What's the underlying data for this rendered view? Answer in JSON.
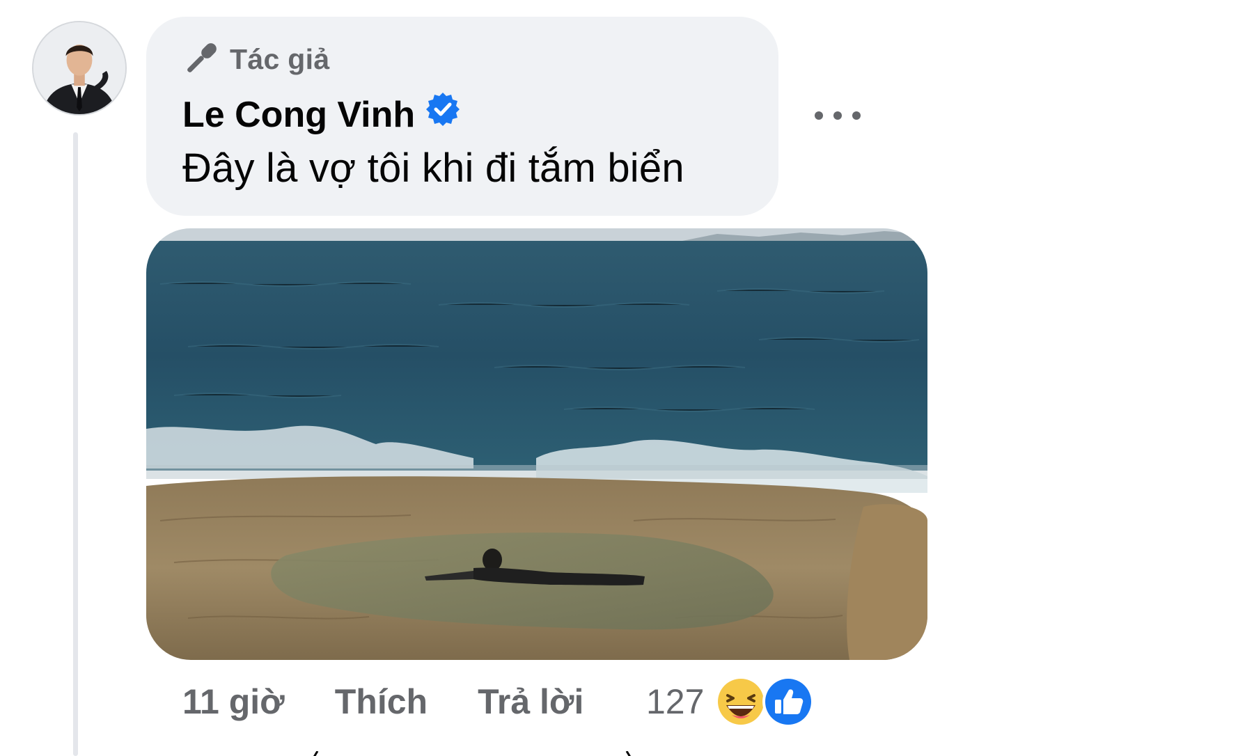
{
  "comment": {
    "author_badge": "Tác giả",
    "author_name": "Le Cong Vinh",
    "text": "Đây là vợ tôi khi đi tắm biển",
    "time": "11 giờ",
    "like_label": "Thích",
    "reply_label": "Trả lời",
    "reaction_count": "127",
    "reactions": [
      "haha",
      "like"
    ]
  },
  "icons": {
    "author_badge_icon": "microphone-icon",
    "verified_icon": "verified-badge-icon",
    "more_icon": "more-options-icon",
    "haha_icon": "haha-reaction-icon",
    "like_icon": "like-reaction-icon"
  },
  "colors": {
    "bubble_bg": "#f0f2f5",
    "secondary_text": "#65676b",
    "primary_text": "#050505",
    "verified_blue": "#1877f2",
    "like_blue": "#1877f2",
    "haha_yellow": "#f7c948"
  }
}
